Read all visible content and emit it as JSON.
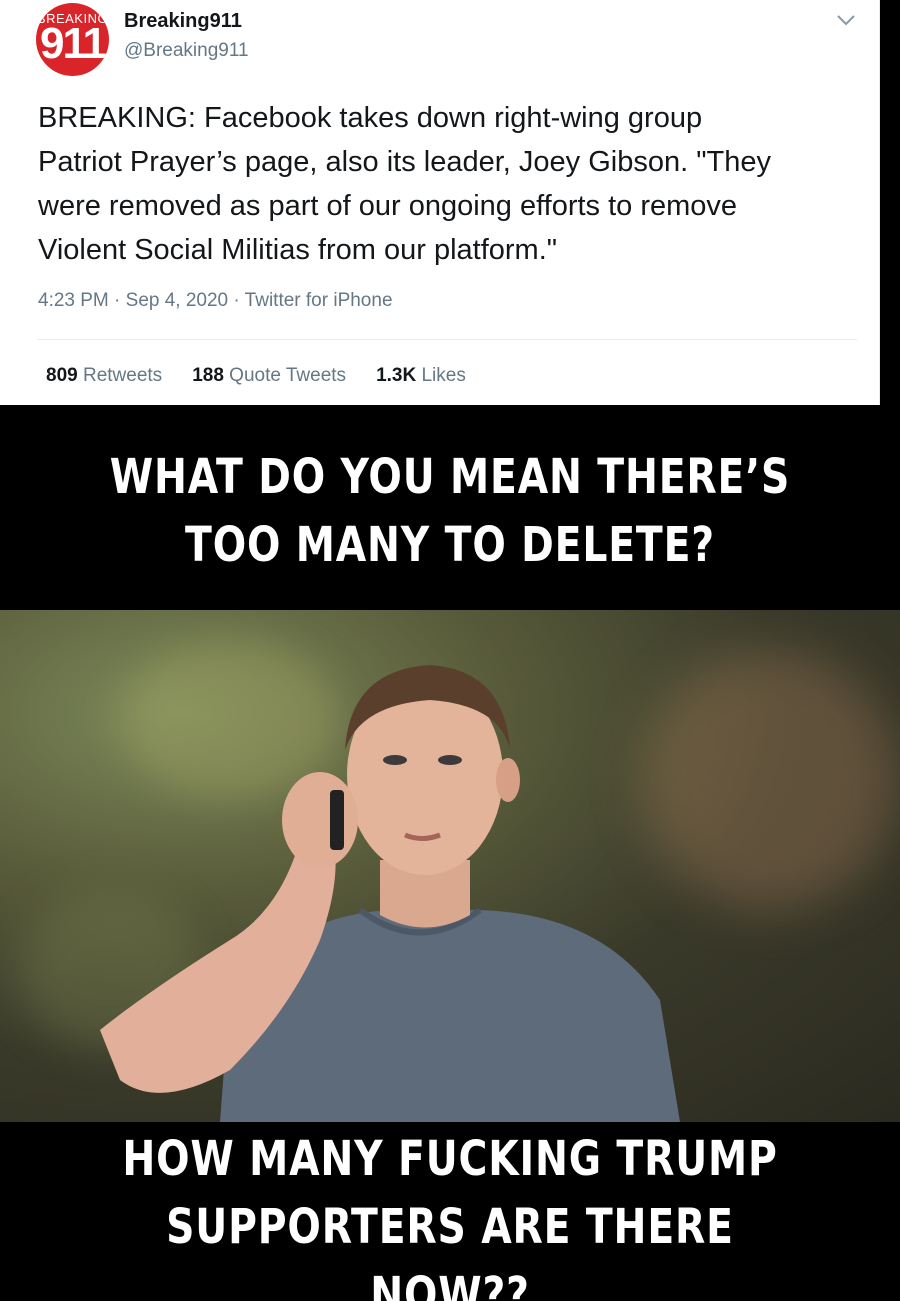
{
  "tweet": {
    "display_name": "Breaking911",
    "handle": "@Breaking911",
    "avatar_text_top": "BREAKING",
    "avatar_text_num": "911",
    "body_lines": [
      "BREAKING: Facebook takes down right-wing group",
      "Patriot Prayer’s page, also its leader, Joey Gibson. \"They",
      "were removed as part of our ongoing efforts to remove",
      "Violent Social Militias from our platform.\""
    ],
    "meta": "4:23 PM · Sep 4, 2020 · Twitter for iPhone",
    "stats": {
      "retweets_count": "809",
      "retweets_label": "Retweets",
      "quote_count": "188",
      "quote_label": "Quote Tweets",
      "likes_count": "1.3K",
      "likes_label": "Likes"
    },
    "chevron_icon": "chevron-down-icon"
  },
  "meme": {
    "top_line1": "WHAT DO YOU MEAN THERE’S",
    "top_line2": "TOO MANY TO DELETE?",
    "bottom_line1": "HOW MANY FUCKING TRUMP",
    "bottom_line2": "SUPPORTERS ARE THERE NOW??"
  },
  "colors": {
    "text_primary": "#14171a",
    "text_secondary": "#657786",
    "avatar_red": "#d9252a"
  }
}
